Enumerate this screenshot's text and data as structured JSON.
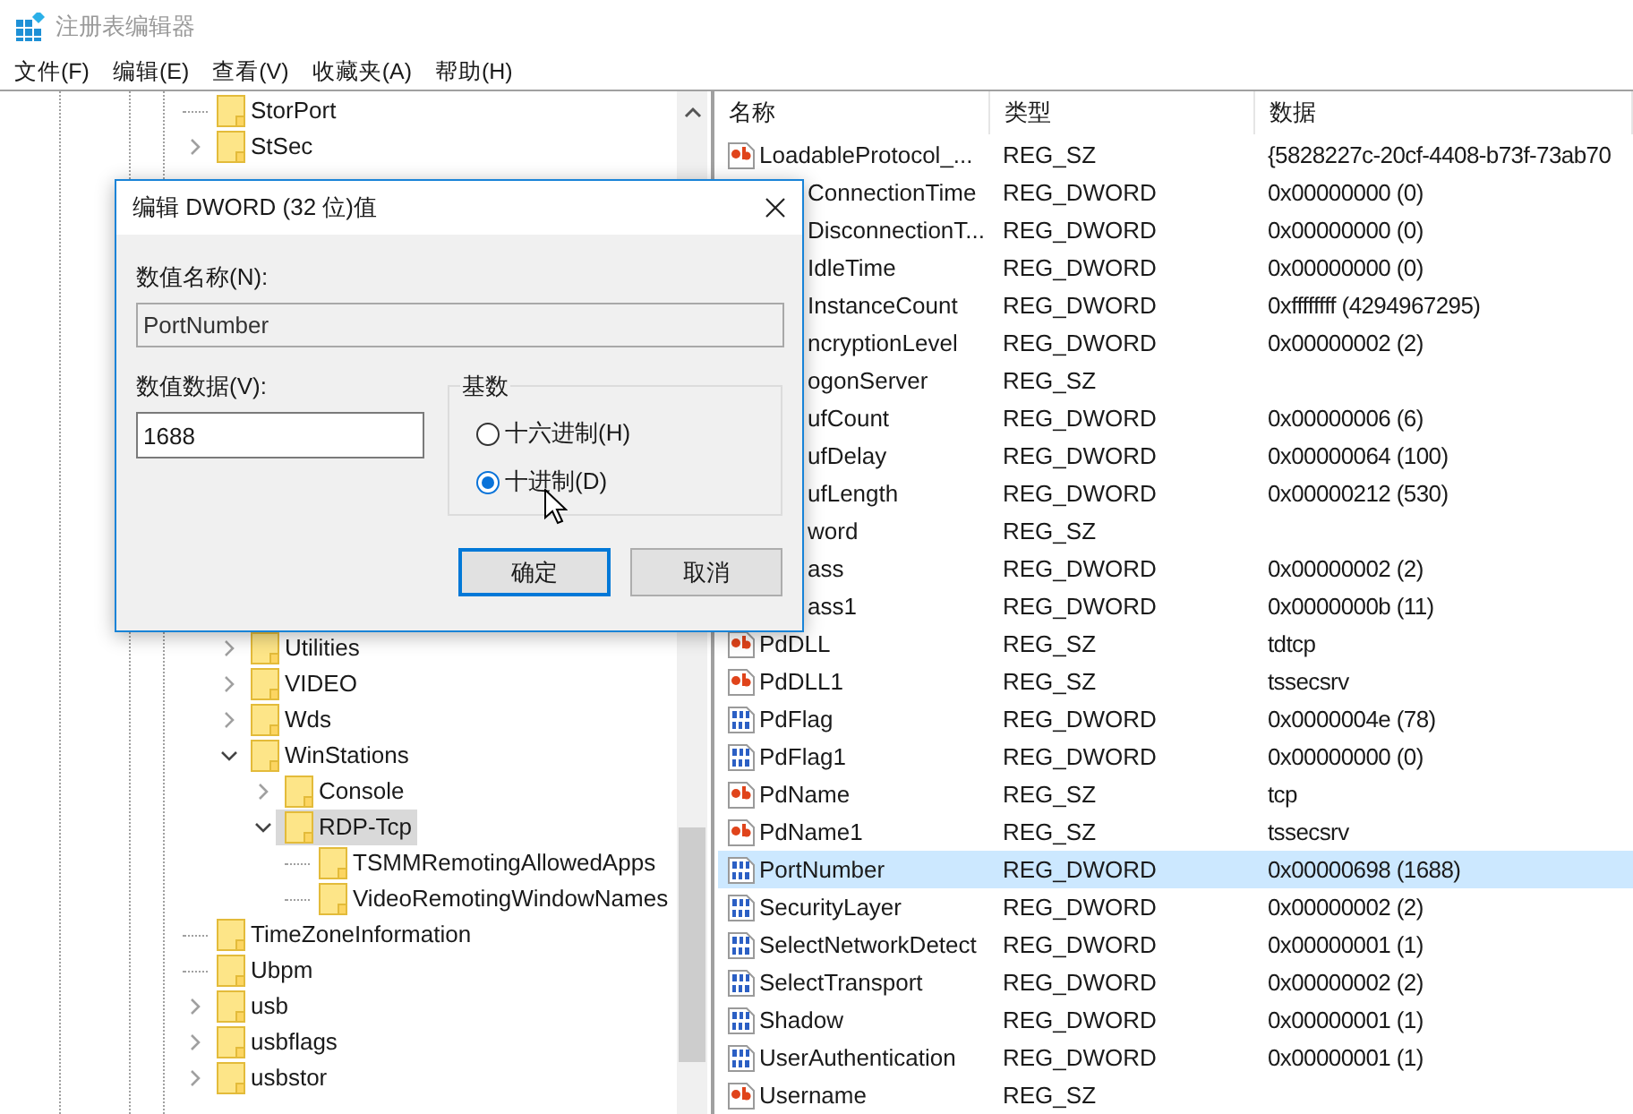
{
  "window": {
    "title": "注册表编辑器"
  },
  "menu": [
    "文件(F)",
    "编辑(E)",
    "查看(V)",
    "收藏夹(A)",
    "帮助(H)"
  ],
  "tree": {
    "items": [
      {
        "label": "StorPort",
        "selected": false
      },
      {
        "label": "StSec",
        "expanded": false,
        "selected": false
      },
      {
        "children": [
          {
            "label": "Utilities",
            "expanded": false,
            "selected": false
          },
          {
            "label": "VIDEO",
            "expanded": false,
            "selected": false
          },
          {
            "label": "Wds",
            "expanded": false,
            "selected": false
          },
          {
            "label": "WinStations",
            "expanded": true,
            "selected": false,
            "children": [
              {
                "label": "Console",
                "expanded": false,
                "selected": false
              },
              {
                "label": "RDP-Tcp",
                "expanded": true,
                "selected": true,
                "children": [
                  {
                    "label": "TSMMRemotingAllowedApps",
                    "selected": false
                  },
                  {
                    "label": "VideoRemotingWindowNames",
                    "selected": false
                  }
                ]
              }
            ]
          }
        ]
      },
      {
        "label": "TimeZoneInformation",
        "selected": false
      },
      {
        "label": "Ubpm",
        "selected": false
      },
      {
        "label": "usb",
        "expanded": false,
        "selected": false
      },
      {
        "label": "usbflags",
        "expanded": false,
        "selected": false
      },
      {
        "label": "usbstor",
        "expanded": false,
        "selected": false
      }
    ]
  },
  "values": {
    "columns": [
      "名称",
      "类型",
      "数据"
    ],
    "rows": [
      {
        "kind": "sz",
        "name": "LoadableProtocol_...",
        "type": "REG_SZ",
        "data": "{5828227c-20cf-4408-b73f-73ab70",
        "selected": false
      },
      {
        "name": "ConnectionTime",
        "type": "REG_DWORD",
        "data": "0x00000000 (0)",
        "selected": false
      },
      {
        "name": "DisconnectionT...",
        "type": "REG_DWORD",
        "data": "0x00000000 (0)",
        "selected": false
      },
      {
        "name": "IdleTime",
        "type": "REG_DWORD",
        "data": "0x00000000 (0)",
        "selected": false
      },
      {
        "name": "InstanceCount",
        "type": "REG_DWORD",
        "data": "0xffffffff (4294967295)",
        "selected": false
      },
      {
        "name": "ncryptionLevel",
        "type": "REG_DWORD",
        "data": "0x00000002 (2)",
        "selected": false
      },
      {
        "name": "ogonServer",
        "type": "REG_SZ",
        "selected": false
      },
      {
        "name": "ufCount",
        "type": "REG_DWORD",
        "data": "0x00000006 (6)",
        "selected": false
      },
      {
        "name": "ufDelay",
        "type": "REG_DWORD",
        "data": "0x00000064 (100)",
        "selected": false
      },
      {
        "name": "ufLength",
        "type": "REG_DWORD",
        "data": "0x00000212 (530)",
        "selected": false
      },
      {
        "name": "word",
        "type": "REG_SZ",
        "selected": false
      },
      {
        "name": "ass",
        "type": "REG_DWORD",
        "data": "0x00000002 (2)",
        "selected": false
      },
      {
        "name": "ass1",
        "type": "REG_DWORD",
        "data": "0x0000000b (11)",
        "selected": false
      },
      {
        "kind": "sz",
        "name": "PdDLL",
        "type": "REG_SZ",
        "data": "tdtcp",
        "selected": false
      },
      {
        "kind": "sz",
        "name": "PdDLL1",
        "type": "REG_SZ",
        "data": "tssecsrv",
        "selected": false
      },
      {
        "kind": "dword",
        "name": "PdFlag",
        "type": "REG_DWORD",
        "data": "0x0000004e (78)",
        "selected": false
      },
      {
        "kind": "dword",
        "name": "PdFlag1",
        "type": "REG_DWORD",
        "data": "0x00000000 (0)",
        "selected": false
      },
      {
        "kind": "sz",
        "name": "PdName",
        "type": "REG_SZ",
        "data": "tcp",
        "selected": false
      },
      {
        "kind": "sz",
        "name": "PdName1",
        "type": "REG_SZ",
        "data": "tssecsrv",
        "selected": false
      },
      {
        "kind": "dword",
        "name": "PortNumber",
        "type": "REG_DWORD",
        "data": "0x00000698 (1688)",
        "selected": true
      },
      {
        "kind": "dword",
        "name": "SecurityLayer",
        "type": "REG_DWORD",
        "data": "0x00000002 (2)",
        "selected": false
      },
      {
        "kind": "dword",
        "name": "SelectNetworkDetect",
        "type": "REG_DWORD",
        "data": "0x00000001 (1)",
        "selected": false
      },
      {
        "kind": "dword",
        "name": "SelectTransport",
        "type": "REG_DWORD",
        "data": "0x00000002 (2)",
        "selected": false
      },
      {
        "kind": "dword",
        "name": "Shadow",
        "type": "REG_DWORD",
        "data": "0x00000001 (1)",
        "selected": false
      },
      {
        "kind": "dword",
        "name": "UserAuthentication",
        "type": "REG_DWORD",
        "data": "0x00000001 (1)",
        "selected": false
      },
      {
        "kind": "sz",
        "name": "Username",
        "type": "REG_SZ",
        "selected": false
      }
    ]
  },
  "dialog": {
    "title": "编辑 DWORD (32 位)值",
    "name_label": "数值名称(N):",
    "name_value": "PortNumber",
    "data_label": "数值数据(V):",
    "data_value": "1688",
    "base": {
      "label": "基数",
      "options": [
        {
          "label": "十六进制(H)",
          "selected": false
        },
        {
          "label": "十进制(D)",
          "selected": true
        }
      ]
    },
    "buttons": [
      {
        "label": "确定",
        "default": true
      },
      {
        "label": "取消",
        "default": false
      }
    ]
  }
}
